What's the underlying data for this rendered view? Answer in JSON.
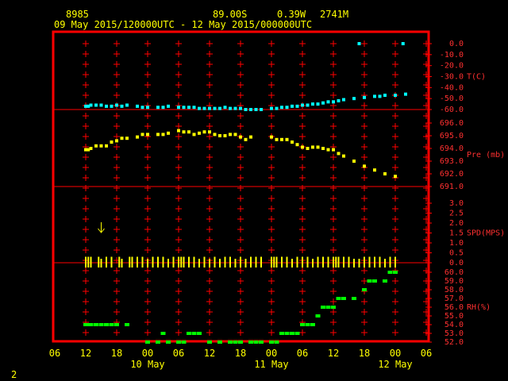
{
  "header": {
    "station": "8985",
    "lat": "89.00S",
    "lon": "0.39W",
    "elev": "2741M",
    "date_range": "09 May 2015/120000UTC - 12 May 2015/000000UTC"
  },
  "footer": {
    "page_number": "2"
  },
  "colors": {
    "frame": "#ff0000",
    "grid": "#ff0000",
    "temp": "#00ffff",
    "pres": "#ffff00",
    "wind": "#ffff00",
    "rh": "#00ff00",
    "text": "#ffff00"
  },
  "chart_data": {
    "type": "scatter",
    "x_ticks": [
      "06",
      "12",
      "18",
      "00",
      "06",
      "12",
      "18",
      "00",
      "06",
      "12",
      "18",
      "00",
      "06"
    ],
    "x_day_labels": [
      {
        "label": "10 May",
        "at_hour": 24
      },
      {
        "label": "11 May",
        "at_hour": 48
      },
      {
        "label": "12 May",
        "at_hour": 72
      }
    ],
    "x_range_hours": [
      6,
      78
    ],
    "panels": [
      {
        "name": "temp",
        "ylabel": "T(C)",
        "ylim": [
          -60,
          0
        ],
        "ticks": [
          "0.0",
          "-10.0",
          "-20.0",
          "-30.0",
          "-40.0",
          "-50.0",
          "-60.0"
        ],
        "x": [
          12,
          12.5,
          13,
          14,
          15,
          16,
          17,
          18,
          19,
          20,
          22,
          23,
          24,
          26,
          27,
          28,
          30,
          31,
          32,
          33,
          34,
          35,
          36,
          37,
          38,
          39,
          40,
          41,
          42,
          43,
          44,
          45,
          46,
          48,
          49,
          50,
          51,
          52,
          53,
          54,
          55,
          56,
          57,
          58,
          59,
          60,
          61,
          62,
          64,
          66,
          68,
          69,
          70,
          72,
          74
        ],
        "y": [
          -57,
          -57,
          -56,
          -56,
          -56,
          -57,
          -57,
          -56,
          -57,
          -56,
          -57,
          -58,
          -58,
          -58,
          -58,
          -57,
          -58,
          -58,
          -58,
          -58,
          -59,
          -59,
          -59,
          -59,
          -59,
          -58,
          -59,
          -59,
          -59,
          -60,
          -60,
          -60,
          -60,
          -59,
          -59,
          -58,
          -58,
          -57,
          -57,
          -56,
          -56,
          -55,
          -55,
          -54,
          -53,
          -53,
          -52,
          -51,
          -50,
          -49,
          -48,
          -48,
          -47,
          -47,
          -46
        ],
        "outliers": {
          "x": [
            65,
            73.5
          ],
          "y": [
            0,
            0
          ]
        }
      },
      {
        "name": "pressure",
        "ylabel": "Pre (mb)",
        "ylim": [
          691,
          696
        ],
        "ticks": [
          "696.0",
          "695.0",
          "694.0",
          "693.0",
          "692.0",
          "691.0"
        ],
        "x": [
          12,
          12.5,
          13,
          14,
          15,
          16,
          17,
          18,
          19,
          20,
          22,
          23,
          24,
          26,
          27,
          28,
          30,
          31,
          32,
          33,
          34,
          35,
          36,
          37,
          38,
          39,
          40,
          41,
          42,
          43,
          44,
          48,
          49,
          50,
          51,
          52,
          53,
          54,
          55,
          56,
          57,
          58,
          59,
          60,
          61,
          62,
          64,
          66,
          68,
          70,
          72
        ],
        "y": [
          693.9,
          693.9,
          694.0,
          694.2,
          694.2,
          694.2,
          694.5,
          694.6,
          694.8,
          694.8,
          694.9,
          695.1,
          695.1,
          695.1,
          695.1,
          695.2,
          695.4,
          695.3,
          695.3,
          695.1,
          695.2,
          695.3,
          695.3,
          695.1,
          695.0,
          695.0,
          695.1,
          695.1,
          694.9,
          694.7,
          694.9,
          694.9,
          694.7,
          694.7,
          694.7,
          694.5,
          694.3,
          694.1,
          694.0,
          694.1,
          694.1,
          694.0,
          693.9,
          693.9,
          693.6,
          693.4,
          693.0,
          692.6,
          692.3,
          692.0,
          691.8
        ]
      },
      {
        "name": "wind",
        "ylabel": "SPD(MPS)",
        "ylim": [
          0,
          3
        ],
        "ticks": [
          "3.0",
          "2.5",
          "2.0",
          "1.5",
          "1.0",
          "0.5",
          "0.0"
        ],
        "arrow": {
          "x": 15,
          "y": 1.8
        },
        "spikes_x": [
          12,
          12.5,
          13,
          14.5,
          15,
          16,
          17,
          18.5,
          19,
          20.5,
          21,
          22,
          23,
          24,
          25,
          26,
          27,
          28,
          29,
          30,
          30.5,
          31,
          32,
          33,
          34,
          35,
          36,
          37,
          38,
          39,
          40,
          41,
          42,
          43,
          44,
          45,
          46,
          48,
          48.5,
          49,
          50,
          51,
          52,
          53,
          54,
          55,
          56,
          57,
          58,
          59,
          60,
          60.5,
          61,
          62,
          63,
          64,
          65,
          66,
          67,
          68,
          69,
          70,
          71,
          72
        ],
        "spikes_y": [
          0.3,
          0.3,
          0.3,
          0.3,
          0.2,
          0.3,
          0.3,
          0.3,
          0.2,
          0.3,
          0.3,
          0.3,
          0.3,
          0.2,
          0.3,
          0.3,
          0.3,
          0.2,
          0.3,
          0.3,
          0.3,
          0.3,
          0.3,
          0.3,
          0.2,
          0.3,
          0.2,
          0.3,
          0.2,
          0.3,
          0.3,
          0.2,
          0.3,
          0.2,
          0.3,
          0.3,
          0.3,
          0.3,
          0.3,
          0.3,
          0.3,
          0.3,
          0.2,
          0.3,
          0.3,
          0.3,
          0.2,
          0.3,
          0.3,
          0.3,
          0.3,
          0.3,
          0.3,
          0.3,
          0.3,
          0.2,
          0.2,
          0.3,
          0.3,
          0.3,
          0.3,
          0.2,
          0.3,
          0.3
        ]
      },
      {
        "name": "rh",
        "ylabel": "RH(%)",
        "ylim": [
          52,
          60
        ],
        "ticks": [
          "60.0",
          "59.0",
          "58.0",
          "57.0",
          "56.0",
          "55.0",
          "54.0",
          "53.0",
          "52.0"
        ],
        "x": [
          12,
          12.5,
          13,
          14,
          15,
          16,
          17,
          18,
          20,
          24,
          26,
          27,
          28,
          30,
          31,
          32,
          33,
          34,
          36,
          38,
          40,
          41,
          42,
          44,
          45,
          46,
          48,
          49,
          50,
          51,
          52,
          53,
          54,
          55,
          56,
          57,
          58,
          59,
          60,
          61,
          62,
          64,
          66,
          67,
          68,
          70,
          71,
          72
        ],
        "y": [
          54,
          54,
          54,
          54,
          54,
          54,
          54,
          54,
          54,
          52,
          52,
          53,
          52,
          52,
          52,
          53,
          53,
          53,
          52,
          52,
          52,
          52,
          52,
          52,
          52,
          52,
          52,
          52,
          53,
          53,
          53,
          53,
          54,
          54,
          54,
          55,
          56,
          56,
          56,
          57,
          57,
          57,
          58,
          59,
          59,
          59,
          60,
          60
        ]
      }
    ]
  }
}
